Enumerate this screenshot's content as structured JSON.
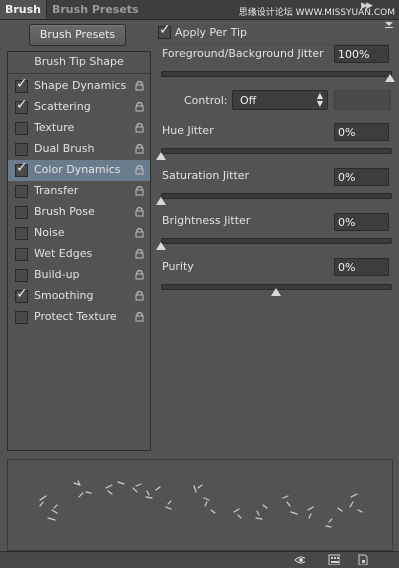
{
  "tabs": [
    {
      "label": "Brush",
      "active": true
    },
    {
      "label": "Brush Presets",
      "active": false
    }
  ],
  "watermark": "思缘设计论坛 WWW.MISSYUAN.COM",
  "brush_presets_button": "Brush Presets",
  "brush_tip_shape": "Brush Tip Shape",
  "options": [
    {
      "label": "Shape Dynamics",
      "checked": true,
      "selected": false
    },
    {
      "label": "Scattering",
      "checked": true,
      "selected": false
    },
    {
      "label": "Texture",
      "checked": false,
      "selected": false
    },
    {
      "label": "Dual Brush",
      "checked": false,
      "selected": false
    },
    {
      "label": "Color Dynamics",
      "checked": true,
      "selected": true
    },
    {
      "label": "Transfer",
      "checked": false,
      "selected": false
    },
    {
      "label": "Brush Pose",
      "checked": false,
      "selected": false
    },
    {
      "label": "Noise",
      "checked": false,
      "selected": false
    },
    {
      "label": "Wet Edges",
      "checked": false,
      "selected": false
    },
    {
      "label": "Build-up",
      "checked": false,
      "selected": false
    },
    {
      "label": "Smoothing",
      "checked": true,
      "selected": false
    },
    {
      "label": "Protect Texture",
      "checked": false,
      "selected": false
    }
  ],
  "apply_per_tip": {
    "label": "Apply Per Tip",
    "checked": true
  },
  "fg_bg_jitter": {
    "label": "Foreground/Background Jitter",
    "value": "100%",
    "level": 1.0
  },
  "control": {
    "label": "Control:",
    "value": "Off"
  },
  "hue_jitter": {
    "label": "Hue Jitter",
    "value": "0%",
    "level": 0.0
  },
  "saturation_jitter": {
    "label": "Saturation Jitter",
    "value": "0%",
    "level": 0.0
  },
  "brightness_jitter": {
    "label": "Brightness Jitter",
    "value": "0%",
    "level": 0.0
  },
  "purity": {
    "label": "Purity",
    "value": "0%",
    "level": 0.5
  },
  "icons": {
    "lock": "lock-icon",
    "menu": "panel-menu-icon",
    "collapse": "collapse-icon",
    "toggle_preview": "toggle-preview-icon",
    "grid": "grid-icon",
    "new_preset": "new-preset-icon"
  },
  "colors": {
    "panel_bg": "#535353",
    "selection": "#6a7b8e",
    "field_bg": "#3d3d3d"
  }
}
